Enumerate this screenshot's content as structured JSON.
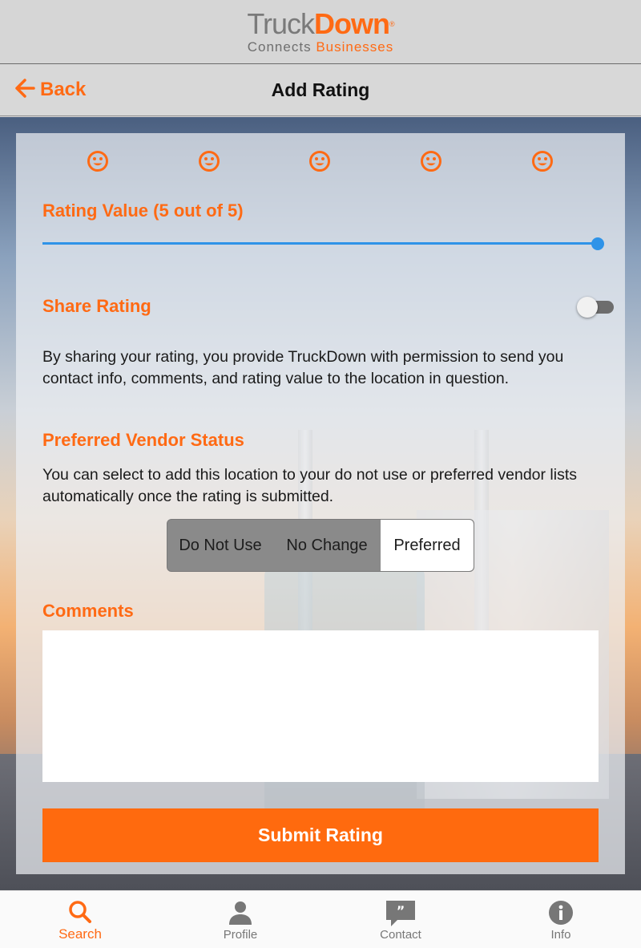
{
  "header": {
    "logo_truck": "Truck",
    "logo_down": "Down",
    "logo_reg": "®",
    "logo_sub_connects": "Connects",
    "logo_sub_businesses": "Businesses"
  },
  "nav": {
    "back_label": "Back",
    "title": "Add Rating"
  },
  "rating": {
    "label": "Rating Value (5 out of 5)",
    "value": 5,
    "max": 5,
    "icons": [
      "smiley-icon",
      "smiley-icon",
      "smiley-icon",
      "smiley-icon",
      "smiley-icon"
    ]
  },
  "share": {
    "label": "Share Rating",
    "enabled": false,
    "description": "By sharing your rating, you provide TruckDown with permission to send you contact info, comments, and rating value to the location in question."
  },
  "vendor": {
    "label": "Preferred Vendor Status",
    "description": "You can select to add this location to your do not use or preferred vendor lists automatically once the rating is submitted.",
    "options": [
      "Do Not Use",
      "No Change",
      "Preferred"
    ],
    "selected": "Preferred"
  },
  "comments": {
    "label": "Comments",
    "value": "",
    "placeholder": ""
  },
  "submit_label": "Submit Rating",
  "tabs": [
    {
      "label": "Search",
      "icon": "search-icon",
      "active": true
    },
    {
      "label": "Profile",
      "icon": "person-icon",
      "active": false
    },
    {
      "label": "Contact",
      "icon": "chat-quote-icon",
      "active": false
    },
    {
      "label": "Info",
      "icon": "info-icon",
      "active": false
    }
  ],
  "colors": {
    "accent": "#ff6a14",
    "slider": "#2e93e8",
    "toggle_off": "#6d6d6d"
  }
}
